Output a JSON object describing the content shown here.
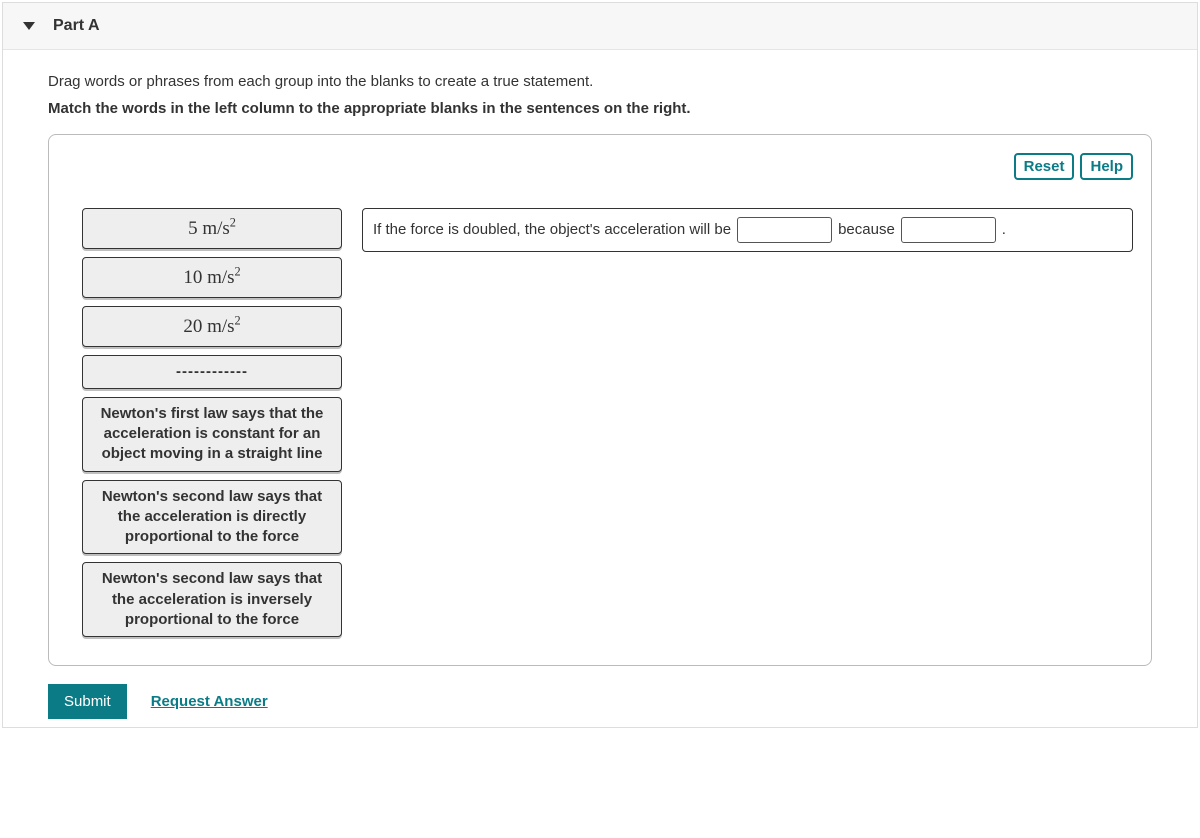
{
  "header": {
    "title": "Part A"
  },
  "instructions": {
    "line1": "Drag words or phrases from each group into the blanks to create a true statement.",
    "line2": "Match the words in the left column to the appropriate blanks in the sentences on the right."
  },
  "toolbar": {
    "reset": "Reset",
    "help": "Help"
  },
  "choices": {
    "c1_value": "5",
    "c2_value": "10",
    "c3_value": "20",
    "unit_prefix": " m/s",
    "unit_sup": "2",
    "divider": "------------",
    "c5": "Newton's first law says that the acceleration is constant for an object moving in a straight line",
    "c6": "Newton's second law says that the acceleration is directly proportional to the force",
    "c7": "Newton's second law says that the acceleration is inversely proportional to the force"
  },
  "sentence": {
    "part1": "If the force is doubled, the object's acceleration will be",
    "part2": "because",
    "part3": "."
  },
  "footer": {
    "submit": "Submit",
    "request": "Request Answer"
  }
}
